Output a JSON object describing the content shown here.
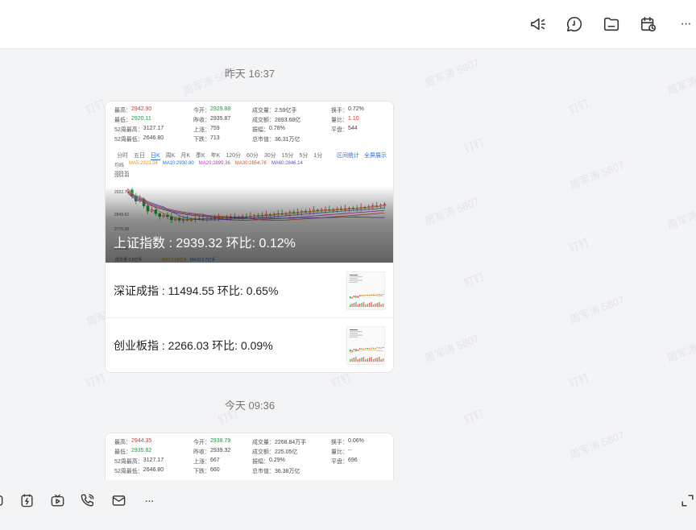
{
  "toolbar": {
    "icons": [
      "megaphone-icon",
      "chat-bubble-icon",
      "folder-icon",
      "calendar-clock-icon",
      "more-icon"
    ],
    "more_label": "···"
  },
  "messages": [
    {
      "time": "昨天 16:37",
      "stats": {
        "rows": [
          [
            [
              "最高：",
              "2942.90",
              "red"
            ],
            [
              "今开：",
              "2929.88",
              "green"
            ],
            [
              "成交量：",
              "2.59亿手",
              "gray"
            ],
            [
              "换手：",
              "0.72%",
              "gray"
            ]
          ],
          [
            [
              "最低：",
              "2920.11",
              "green"
            ],
            [
              "昨收：",
              "2935.87",
              "gray"
            ],
            [
              "成交额：",
              "2893.68亿",
              "gray"
            ],
            [
              "量比：",
              "1.10",
              "red"
            ]
          ],
          [
            [
              "52周最高：",
              "3127.17",
              "gray"
            ],
            [
              "上涨：",
              "759",
              "gray"
            ],
            [
              "振幅：",
              "0.78%",
              "gray"
            ],
            [
              "平盘：",
              "544",
              "gray"
            ]
          ],
          [
            [
              "52周最低：",
              "2646.80",
              "gray"
            ],
            [
              "下跌：",
              "713",
              "gray"
            ],
            [
              "总市值：",
              "36.31万亿",
              "gray"
            ],
            [
              "",
              "",
              "gray"
            ]
          ]
        ]
      },
      "tabs": [
        "分时",
        "五日",
        "日K",
        "周K",
        "月K",
        "季K",
        "年K",
        "120分",
        "60分",
        "30分",
        "15分",
        "5分",
        "1分"
      ],
      "active_tab": "日K",
      "tab_links": [
        "区间统计",
        "全屏展示"
      ],
      "ma_legend": [
        "均线",
        "MA5:2923.34",
        "MA10:2930.80",
        "MA20:2899.36",
        "MA30:2854.76",
        "MA60:2846.14"
      ],
      "price_labels": [
        "3068.56",
        "2954.44",
        "2922.73",
        "2849.62",
        "2776.58",
        "2646.80"
      ],
      "volume_legend": [
        "成交量 0.5亿手",
        "MA5:2.59亿手",
        "MA10:2.7亿手"
      ],
      "title": "上证指数 : 2939.32 环比: 0.12%",
      "items": [
        {
          "text": "深证成指 : 11494.55 环比: 0.65%"
        },
        {
          "text": "创业板指 : 2266.03 环比: 0.09%"
        }
      ]
    },
    {
      "time": "今天 09:36",
      "stats": {
        "rows": [
          [
            [
              "最高：",
              "2944.35",
              "red"
            ],
            [
              "今开：",
              "2938.79",
              "green"
            ],
            [
              "成交量：",
              "2268.84万手",
              "gray"
            ],
            [
              "换手：",
              "0.06%",
              "gray"
            ]
          ],
          [
            [
              "最低：",
              "2935.82",
              "green"
            ],
            [
              "昨收：",
              "2939.32",
              "gray"
            ],
            [
              "成交额：",
              "225.05亿",
              "gray"
            ],
            [
              "量比：",
              "--",
              "gray"
            ]
          ],
          [
            [
              "52周最高：",
              "3127.17",
              "gray"
            ],
            [
              "上涨：",
              "667",
              "gray"
            ],
            [
              "振幅：",
              "0.29%",
              "gray"
            ],
            [
              "平盘：",
              "696",
              "gray"
            ]
          ],
          [
            [
              "52周最低：",
              "2646.80",
              "gray"
            ],
            [
              "下跌：",
              "660",
              "gray"
            ],
            [
              "总市值：",
              "36.38万亿",
              "gray"
            ],
            [
              "",
              "",
              "gray"
            ]
          ]
        ]
      }
    }
  ],
  "watermark": "周军涛 5807",
  "watermark_app": "钉钉",
  "bottom": {
    "icons": [
      "partial-icon",
      "lightning-doc-icon",
      "video-icon",
      "phone-icon",
      "mail-icon",
      "more-icon",
      "expand-icon"
    ],
    "more_label": "···"
  },
  "colors": {
    "up": "#e03030",
    "down": "#1a9a3a",
    "accent": "#2a6fdb"
  }
}
